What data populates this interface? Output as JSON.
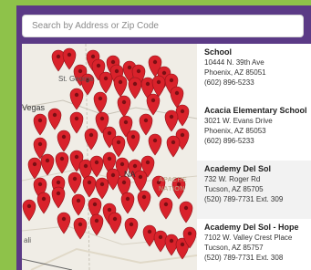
{
  "search": {
    "placeholder": "Search by Address or Zip Code",
    "value": ""
  },
  "map": {
    "labels": {
      "st_george": "St. George",
      "vegas": "Vegas",
      "na": "NA",
      "apache": "APACHE",
      "nation": "NATION",
      "mali": "ali"
    },
    "pin_color": "#d9222b",
    "pin_icon": "map-marker"
  },
  "colors": {
    "background": "#5b3a86",
    "accent": "#8ec24a",
    "pin": "#d9222b"
  },
  "schools": [
    {
      "name": "School",
      "address": "10444 N. 39th Ave",
      "city": "Phoenix, AZ 85051",
      "phone": "(602) 896-5233"
    },
    {
      "name": "Acacia Elementary School",
      "address": "3021 W. Evans Drive",
      "city": "Phoenix, AZ 85053",
      "phone": "(602) 896-5233"
    },
    {
      "name": "Academy Del Sol",
      "address": "732 W. Roger Rd",
      "city": "Tucson, AZ 85705",
      "phone": "(520) 789-7731 Ext. 309"
    },
    {
      "name": "Academy Del Sol - Hope",
      "address": "7102 W. Valley Crest Place",
      "city": "Tucson, AZ 85757",
      "phone": "(520) 789-7731 Ext. 308"
    }
  ]
}
